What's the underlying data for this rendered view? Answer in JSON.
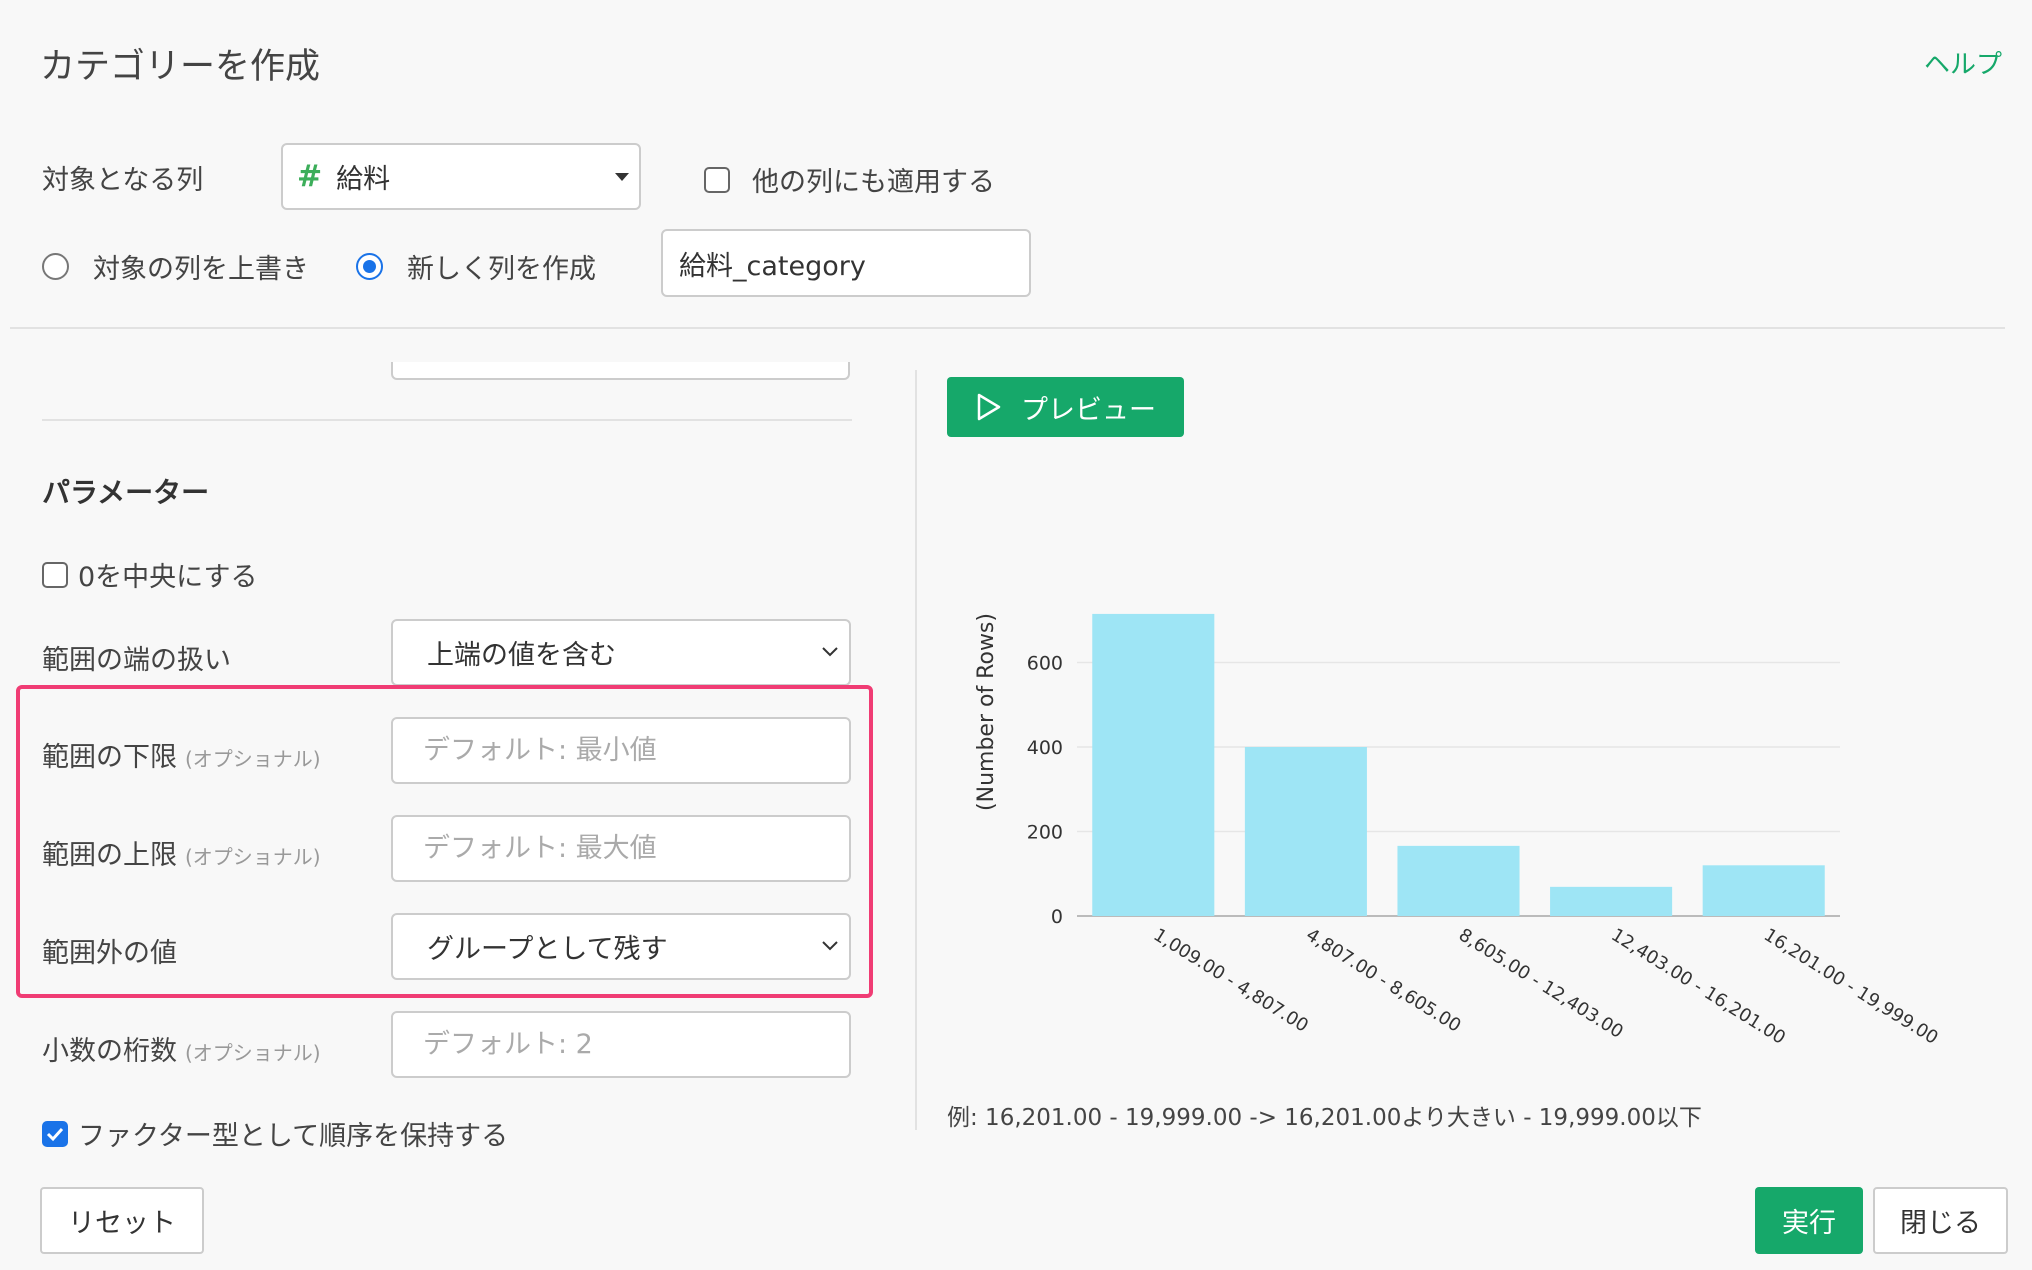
{
  "dialog": {
    "title": "カテゴリーを作成",
    "help": "ヘルプ"
  },
  "target": {
    "label": "対象となる列",
    "column_icon": "#",
    "column_value": "給料",
    "apply_other_label": "他の列にも適用する",
    "apply_other_checked": false
  },
  "output": {
    "overwrite_label": "対象の列を上書き",
    "new_column_label": "新しく列を作成",
    "selected": "new",
    "new_column_name": "給料_category"
  },
  "params": {
    "heading": "パラメーター",
    "center_zero_label": "0を中央にする",
    "center_zero_checked": false,
    "edge_label": "範囲の端の扱い",
    "edge_value": "上端の値を含む",
    "lower_label": "範囲の下限",
    "lower_placeholder": "デフォルト: 最小値",
    "upper_label": "範囲の上限",
    "upper_placeholder": "デフォルト: 最大値",
    "outside_label": "範囲外の値",
    "outside_value": "グループとして残す",
    "decimals_label": "小数の桁数",
    "decimals_placeholder": "デフォルト: 2",
    "optional_tag": "(オプショナル)",
    "factor_label": "ファクター型として順序を保持する",
    "factor_checked": true
  },
  "preview": {
    "button_label": "プレビュー"
  },
  "example_text": "例: 16,201.00 - 19,999.00 -> 16,201.00より大きい - 19,999.00以下",
  "footer": {
    "reset": "リセット",
    "run": "実行",
    "close": "閉じる"
  },
  "colors": {
    "accent": "#16a86a",
    "bar": "#9ee5f5",
    "highlight": "#f03c74"
  },
  "chart_data": {
    "type": "bar",
    "categories": [
      "1,009.00 - 4,807.00",
      "4,807.00 - 8,605.00",
      "8,605.00 - 12,403.00",
      "12,403.00 - 16,201.00",
      "16,201.00 - 19,999.00"
    ],
    "values": [
      715,
      400,
      166,
      69,
      120
    ],
    "ylabel": "(Number of Rows)",
    "yticks": [
      0,
      200,
      400,
      600
    ],
    "ylim": [
      0,
      720
    ],
    "grid": true
  }
}
